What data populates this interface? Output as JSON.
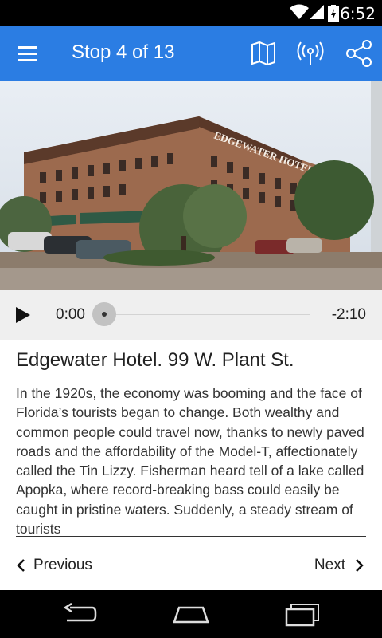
{
  "status_bar": {
    "time": "6:52",
    "icons": [
      "wifi-icon",
      "signal-icon",
      "battery-icon"
    ]
  },
  "app_bar": {
    "title": "Stop 4 of 13",
    "actions": [
      "map-icon",
      "broadcast-icon",
      "share-icon"
    ],
    "color": "#2b7de3"
  },
  "hero": {
    "alt": "Edgewater Hotel building photo",
    "sign_text": "EDGEWATER HOTEL"
  },
  "player": {
    "current_time": "0:00",
    "remaining_time": "-2:10",
    "progress": 0.0
  },
  "stop": {
    "title": "Edgewater Hotel.  99 W. Plant St.",
    "body": "In the 1920s, the economy was booming and the face of Florida’s tourists began to change.  Both wealthy and common people could travel now, thanks to newly paved roads and the affordability of the Model-T, affectionately called the Tin Lizzy. Fisherman heard tell of a lake called Apopka, where record-breaking bass could easily be caught in pristine waters. Suddenly, a steady stream of tourists"
  },
  "navigation": {
    "previous_label": "Previous",
    "next_label": "Next"
  }
}
